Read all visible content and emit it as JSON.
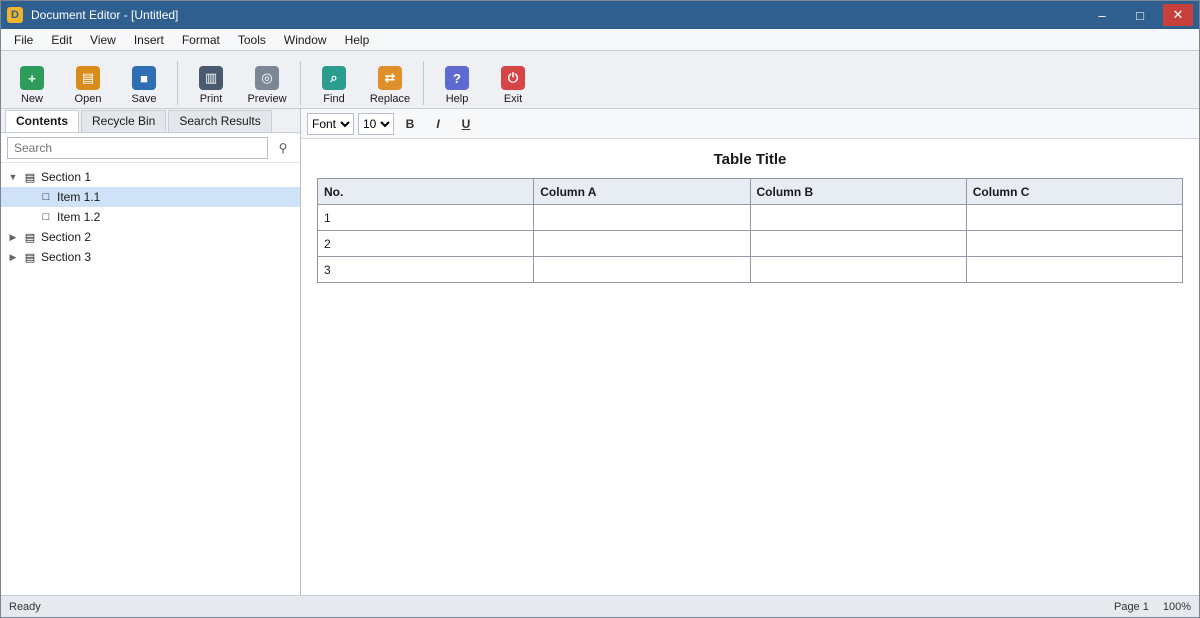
{
  "window": {
    "title": "Document Editor - [Untitled]",
    "minimize_glyph": "–",
    "maximize_glyph": "□",
    "close_glyph": "✕"
  },
  "menu": [
    "File",
    "Edit",
    "View",
    "Insert",
    "Format",
    "Tools",
    "Window",
    "Help"
  ],
  "toolbar": {
    "groups": [
      [
        {
          "name": "new-button",
          "icon": "new-icon",
          "glyph": "+",
          "color": "#2e9d5b",
          "label": "New"
        },
        {
          "name": "open-button",
          "icon": "folder-icon",
          "glyph": "▤",
          "color": "#d98b1c",
          "label": "Open"
        },
        {
          "name": "save-button",
          "icon": "save-icon",
          "glyph": "■",
          "color": "#2f6fb5",
          "label": "Save"
        }
      ],
      [
        {
          "name": "print-button",
          "icon": "print-icon",
          "glyph": "▥",
          "color": "#4a5a6e",
          "label": "Print"
        },
        {
          "name": "preview-button",
          "icon": "preview-icon",
          "glyph": "◎",
          "color": "#7b8794",
          "label": "Preview"
        }
      ],
      [
        {
          "name": "find-button",
          "icon": "search-icon",
          "glyph": "⌕",
          "color": "#2a9d8f",
          "label": "Find"
        },
        {
          "name": "replace-button",
          "icon": "replace-icon",
          "glyph": "⇄",
          "color": "#e0902a",
          "label": "Replace"
        }
      ],
      [
        {
          "name": "help-button",
          "icon": "help-icon",
          "glyph": "?",
          "color": "#5e6ad2",
          "label": "Help"
        },
        {
          "name": "exit-button",
          "icon": "power-icon",
          "glyph": "⏻",
          "color": "#d64545",
          "label": "Exit"
        }
      ]
    ]
  },
  "sidebar": {
    "tabs": [
      "Contents",
      "Recycle Bin",
      "Search Results"
    ],
    "search": {
      "value": "",
      "placeholder": "Search"
    },
    "tree": [
      {
        "label": "Section 1",
        "level": 0,
        "expanded": true,
        "icon": "folder-icon",
        "glyph": "▤",
        "selected": false
      },
      {
        "label": "Item 1.1",
        "level": 1,
        "expanded": false,
        "icon": "doc-icon",
        "glyph": "□",
        "selected": true
      },
      {
        "label": "Item 1.2",
        "level": 1,
        "expanded": false,
        "icon": "doc-icon",
        "glyph": "□",
        "selected": false
      },
      {
        "label": "Section 2",
        "level": 0,
        "expanded": false,
        "icon": "folder-icon",
        "glyph": "▤",
        "selected": false
      },
      {
        "label": "Section 3",
        "level": 0,
        "expanded": false,
        "icon": "folder-icon",
        "glyph": "▤",
        "selected": false
      }
    ]
  },
  "format": {
    "font_options": [
      "Font"
    ],
    "size_options": [
      "10"
    ],
    "bold_glyph": "B",
    "italic_glyph": "I",
    "underline_glyph": "U"
  },
  "document": {
    "title": "Table Title",
    "headers": [
      "No.",
      "Column A",
      "Column B",
      "Column C"
    ],
    "rows": [
      [
        "1",
        "",
        "",
        ""
      ],
      [
        "2",
        "",
        "",
        ""
      ],
      [
        "3",
        "",
        "",
        ""
      ]
    ]
  },
  "status": {
    "left": "Ready",
    "page": "Page 1",
    "zoom": "100%"
  }
}
